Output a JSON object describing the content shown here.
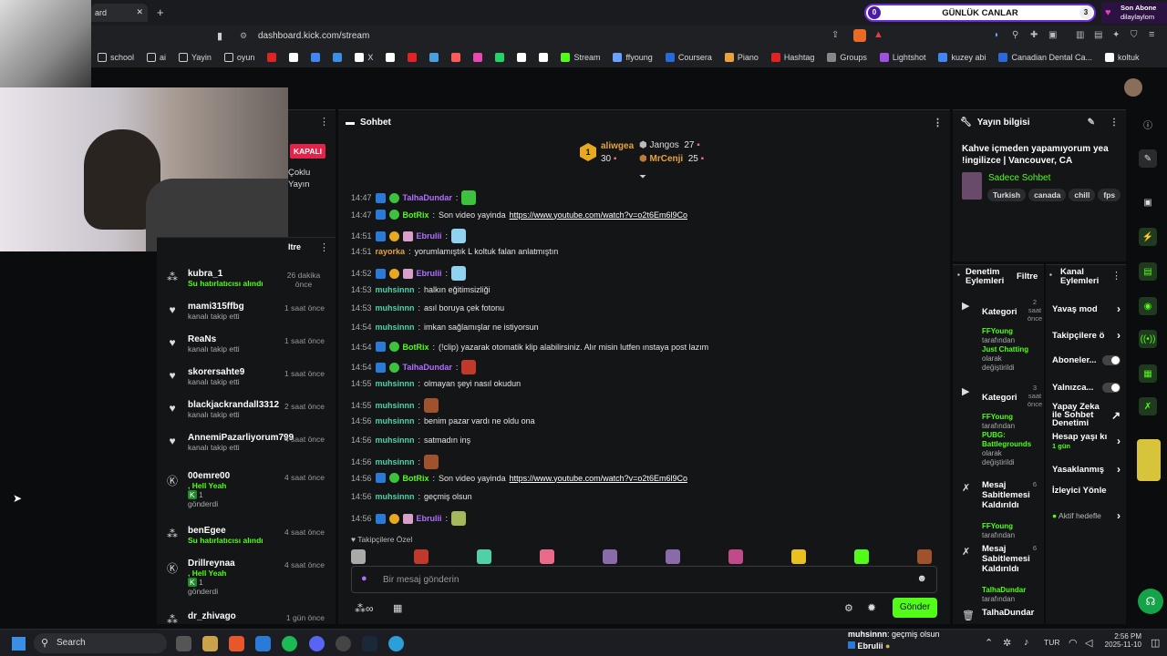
{
  "browser": {
    "tab_title": "ard",
    "url": "dashboard.kick.com/stream",
    "bookmarks": [
      "school",
      "ai",
      "Yayin",
      "oyun",
      "",
      "",
      "",
      "",
      "X",
      "",
      "",
      "",
      "",
      "",
      "",
      "",
      "",
      "Stream",
      "ffyoung",
      "Coursera",
      "Piano",
      "Hashtag",
      "Groups",
      "Lightshot",
      "kuzey abi",
      "Canadian Dental Ca...",
      "koltuk"
    ]
  },
  "goal_widget": {
    "left": "0",
    "title": "GÜNLÜK CANLAR",
    "right": "3"
  },
  "last_sub": {
    "label": "Son Abone",
    "name": "dilaylaylom"
  },
  "stream_status": {
    "badge": "KAPALI",
    "multi_label": "Çoklu Yayın",
    "filter": "ltre"
  },
  "activity": [
    {
      "name": "kubra_1",
      "sub": "Su hatırlatıcısı alındı",
      "time": "26 dakika önce",
      "icon": "gift-icon",
      "subgreen": true
    },
    {
      "name": "mami315ffbg",
      "sub": "kanalı takip etti",
      "time": "1 saat önce",
      "icon": "heart-icon"
    },
    {
      "name": "ReaNs",
      "sub": "kanalı takip etti",
      "time": "1 saat önce",
      "icon": "heart-icon"
    },
    {
      "name": "skorersahte9",
      "sub": "kanalı takip etti",
      "time": "1 saat önce",
      "icon": "heart-icon"
    },
    {
      "name": "blackjackrandall3312",
      "sub": "kanalı takip etti",
      "time": "2 saat önce",
      "icon": "heart-icon"
    },
    {
      "name": "AnnemiPazarliyorum799",
      "sub": "kanalı takip etti",
      "time": "4 saat önce",
      "icon": "heart-icon"
    },
    {
      "name": "00emre00",
      "sub": ", Hell Yeah",
      "sub2": "1",
      "sub3": "gönderdi",
      "time": "4 saat önce",
      "icon": "kick-icon"
    },
    {
      "name": "benEgee",
      "sub": "Su hatırlatıcısı alındı",
      "time": "4 saat önce",
      "icon": "gift-icon",
      "subgreen": true
    },
    {
      "name": "Drillreynaa",
      "sub": ", Hell Yeah",
      "sub2": "1",
      "sub3": "gönderdi",
      "time": "4 saat önce",
      "icon": "kick-icon"
    },
    {
      "name": "dr_zhivago",
      "sub": "",
      "time": "1 gün önce",
      "icon": "gift-icon"
    }
  ],
  "chat": {
    "title": "Sohbet",
    "top": [
      {
        "name": "aliwgea",
        "count": "30"
      },
      {
        "name": "Jangos",
        "count": "27"
      },
      {
        "name": "MrCenji",
        "count": "25"
      }
    ],
    "messages": [
      {
        "t": "14:47",
        "u": "TalhaDundar",
        "c": "#b070ff",
        "text": "",
        "emote": "#3cc23c"
      },
      {
        "t": "14:47",
        "u": "BotRix",
        "c": "#53fc18",
        "text": "Son video yayinda ",
        "link": "https://www.youtube.com/watch?v=o2t6Em6l9Co"
      },
      {
        "t": "14:51",
        "u": "Ebrulii",
        "c": "#b070ff",
        "text": "",
        "emote": "#8fd3f0"
      },
      {
        "t": "14:51",
        "u": "rayorka",
        "c": "#e8a33a",
        "text": "yorumlamıştık L koltuk falan anlatmıştın"
      },
      {
        "t": "14:52",
        "u": "Ebrulii",
        "c": "#b070ff",
        "text": "",
        "emote": "#8fd3f0"
      },
      {
        "t": "14:53",
        "u": "muhsinnn",
        "c": "#4fd1a5",
        "text": "halkın eğitimsizliği"
      },
      {
        "t": "14:53",
        "u": "muhsinnn",
        "c": "#4fd1a5",
        "text": "asıl boruya çek fotonu"
      },
      {
        "t": "14:54",
        "u": "muhsinnn",
        "c": "#4fd1a5",
        "text": "imkan sağlamışlar ne istiyorsun"
      },
      {
        "t": "14:54",
        "u": "BotRix",
        "c": "#53fc18",
        "text": "(!clip) yazarak otomatik klip alabilirsiniz. Alır misin lutfen ınstaya post lazım"
      },
      {
        "t": "14:54",
        "u": "TalhaDundar",
        "c": "#b070ff",
        "text": "",
        "emote": "#c0392b"
      },
      {
        "t": "14:55",
        "u": "muhsinnn",
        "c": "#4fd1a5",
        "text": "olmayan şeyi nasıl okudun"
      },
      {
        "t": "14:55",
        "u": "muhsinnn",
        "c": "#4fd1a5",
        "text": "",
        "emote": "#a0522d"
      },
      {
        "t": "14:56",
        "u": "muhsinnn",
        "c": "#4fd1a5",
        "text": "benim pazar vardı ne oldu ona"
      },
      {
        "t": "14:56",
        "u": "muhsinnn",
        "c": "#4fd1a5",
        "text": "satmadın inş"
      },
      {
        "t": "14:56",
        "u": "muhsinnn",
        "c": "#4fd1a5",
        "text": "",
        "emote": "#a0522d"
      },
      {
        "t": "14:56",
        "u": "BotRix",
        "c": "#53fc18",
        "text": "Son video yayinda ",
        "link": "https://www.youtube.com/watch?v=o2t6Em6l9Co"
      },
      {
        "t": "14:56",
        "u": "muhsinnn",
        "c": "#4fd1a5",
        "text": "geçmiş olsun"
      },
      {
        "t": "14:56",
        "u": "Ebrulii",
        "c": "#b070ff",
        "text": "",
        "emote": "#a5b85a"
      }
    ],
    "followers_only": "Takipçilere Özel",
    "placeholder": "Bir mesaj gönderin",
    "send": "Gönder"
  },
  "stream_info": {
    "title": "Yayın bilgisi",
    "stream_title": "Kahve içmeden yapamıyorum yea !ingilizce | Vancouver, CA",
    "category": "Sadece Sohbet",
    "tags": [
      "Turkish",
      "canada",
      "chill",
      "fps"
    ]
  },
  "moderation": {
    "title": "Denetim Eylemleri",
    "filter": "Filtre",
    "items": [
      {
        "title": "Kategori",
        "count": "2",
        "time": "saat önce",
        "by": "FFYoung",
        "by_sub": "tarafından",
        "val": "Just Chatting",
        "tail1": "olarak",
        "tail2": "değiştirildi"
      },
      {
        "title": "Kategori",
        "count": "3",
        "time": "saat önce",
        "by": "FFYoung",
        "by_sub": "tarafından",
        "val": "PUBG: Battlegrounds",
        "tail1": "olarak",
        "tail2": "değiştirildi"
      },
      {
        "title": "Mesaj Sabitlemesi Kaldırıldı",
        "count": "6",
        "by": "FFYoung",
        "by_sub": "tarafından"
      },
      {
        "title": "Mesaj Sabitlemesi Kaldırıldı",
        "count": "6",
        "by": "TalhaDundar",
        "by_sub": "tarafından"
      },
      {
        "title": "TalhaDundar"
      }
    ]
  },
  "channel": {
    "title": "Kanal Eylemleri",
    "rows": [
      "Yavaş mod",
      "Takipçilere ö",
      "Aboneler...",
      "Yalnızca...",
      "Yapay Zeka ile Sohbet Denetimi",
      "Hesap yaşı kı",
      "Yasaklanmış",
      "İzleyici Yönlendir",
      "Aktif hedefle"
    ],
    "hesap_sub": "1 gün"
  },
  "overlay": {
    "user": "muhsinnn",
    "text": ": geçmiş olsun",
    "user2": "Ebrulii"
  },
  "taskbar": {
    "search": "Search",
    "lang": "TUR",
    "time": "2:56 PM",
    "date": "2025-11-10"
  },
  "colors": {
    "accent": "#53fc18",
    "bg": "#0b0c0e",
    "panel": "#141517"
  }
}
